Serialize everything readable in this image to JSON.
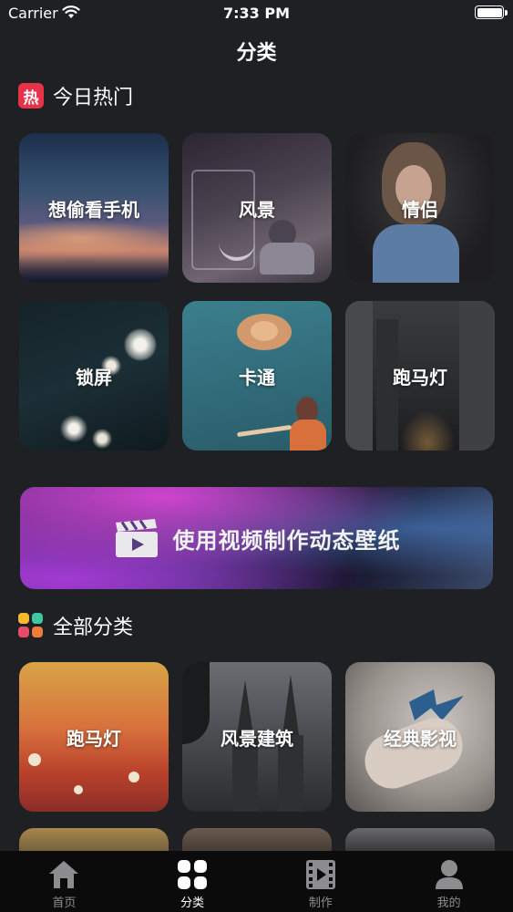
{
  "status": {
    "carrier": "Carrier",
    "time": "7:33 PM"
  },
  "page": {
    "title": "分类"
  },
  "hot": {
    "title": "今日热门",
    "badge": "热",
    "tiles": [
      {
        "label": "想偷看手机"
      },
      {
        "label": "风景"
      },
      {
        "label": "情侣"
      },
      {
        "label": "锁屏"
      },
      {
        "label": "卡通"
      },
      {
        "label": "跑马灯"
      }
    ]
  },
  "banner": {
    "text": "使用视频制作动态壁纸"
  },
  "all": {
    "title": "全部分类",
    "tiles": [
      {
        "label": "跑马灯"
      },
      {
        "label": "风景建筑"
      },
      {
        "label": "经典影视"
      }
    ]
  },
  "tabs": [
    {
      "label": "首页",
      "icon": "home-icon",
      "active": false
    },
    {
      "label": "分类",
      "icon": "grid-icon",
      "active": true
    },
    {
      "label": "制作",
      "icon": "film-icon",
      "active": false
    },
    {
      "label": "我的",
      "icon": "user-icon",
      "active": false
    }
  ],
  "colors": {
    "background": "#1f2023",
    "hot_badge": "#e8324a",
    "tab_bar": "#0b0b0c",
    "tab_inactive": "#8d8d8f",
    "tab_active": "#ffffff"
  }
}
